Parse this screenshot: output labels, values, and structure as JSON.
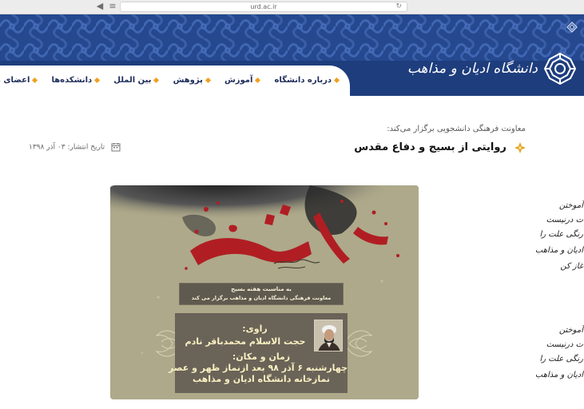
{
  "browser": {
    "url": "urd.ac.ir",
    "back_glyph": "◀",
    "menu_glyph": "≡",
    "refresh_glyph": "↻"
  },
  "header": {
    "logo_text": "دانشگاه ادیان و مذاهب",
    "nav": [
      "درباره دانشگاه",
      "آموزش",
      "پژوهش",
      "بین الملل",
      "دانشکده‌ها",
      "اعضای هیئ"
    ]
  },
  "article": {
    "pretitle": "معاونت فرهنگی دانشجویی برگزار می‌کند:",
    "title": "روایتی از بسیج و دفاع مقدس",
    "publish_label": "تاریخ انتشار:",
    "publish_date": "۰۳ آذر ۱۳۹۸"
  },
  "poster": {
    "band_line1": "به مناسبت هفته بسیج",
    "band_line2": "معاونت فرهنگی دانشگاه ادیان و مذاهب برگزار می کند",
    "ravi_label": "راوی:",
    "speaker": "حجت الاسلام محمدباقر نادم",
    "timeplace_label": "زمان و مکان:",
    "when": "چهارشنبه ۶ آذر ۹۸ بعد ازنماز ظهر و عصر",
    "where": "نمازخانه دانشگاه ادیان و مذاهب"
  },
  "side_poem": {
    "lines": [
      "آموختن",
      "ت درنیست",
      "رنگی علت را",
      "ادیان و مذاهب",
      "غاز کن",
      "آموختن",
      "ت درنیست",
      "رنگی علت را",
      "ادیان و مذاهب"
    ]
  },
  "colors": {
    "header_blue": "#1e3d7d",
    "nav_diamond": "#f0a01c",
    "title_bullet": "#e0a21e",
    "poster_bg": "#aea98a"
  }
}
